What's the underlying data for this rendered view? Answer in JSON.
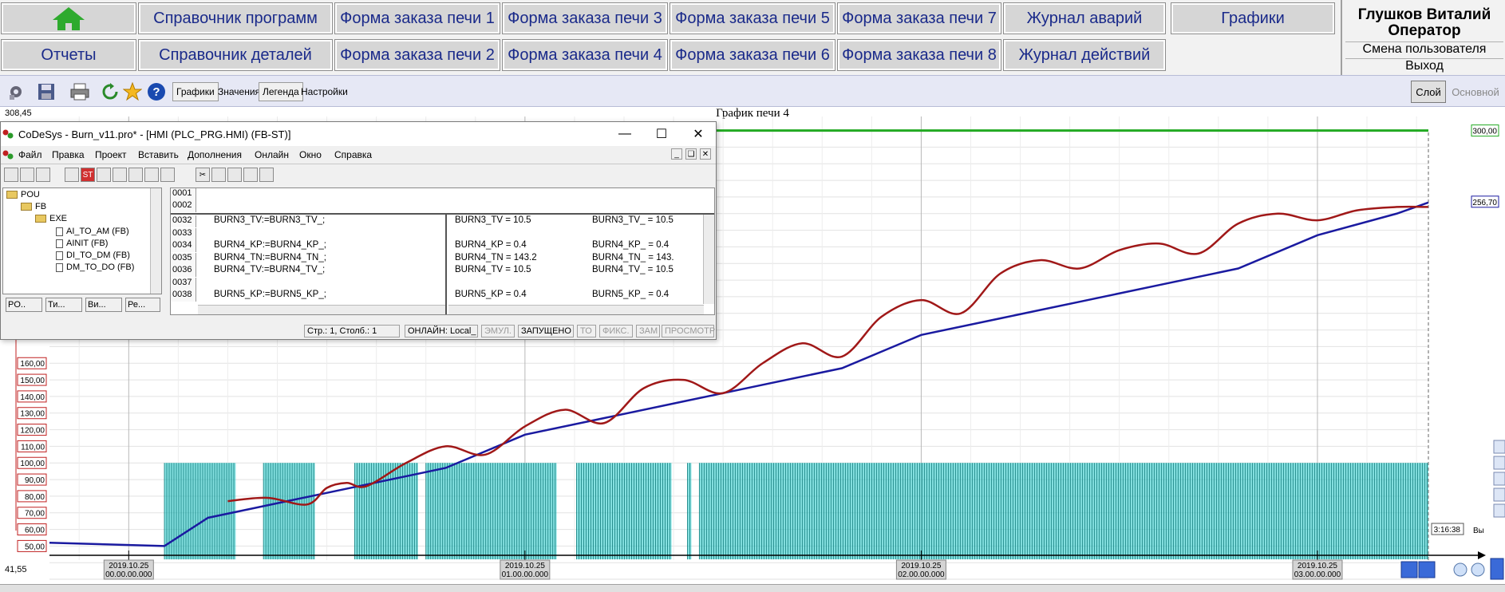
{
  "nav": {
    "row1": [
      "Справочник программ",
      "Форма заказа печи 1",
      "Форма заказа печи 3",
      "Форма заказа печи 5",
      "Форма заказа печи 7",
      "Журнал аварий",
      "Графики"
    ],
    "row2": [
      "Отчеты",
      "Справочник деталей",
      "Форма заказа печи 2",
      "Форма заказа печи 4",
      "Форма заказа печи 6",
      "Форма заказа печи 8",
      "Журнал действий"
    ],
    "home_icon": "home-icon"
  },
  "user": {
    "name": "Глушков Виталий",
    "role": "Оператор",
    "switch_label": "Смена пользователя",
    "exit_label": "Выход"
  },
  "toolbar": {
    "icons": [
      "settings-icon",
      "save-icon",
      "print-icon",
      "refresh-icon",
      "star-icon",
      "help-icon"
    ],
    "tabs": [
      "Графики",
      "Значения",
      "Легенда",
      "Настройки"
    ],
    "layer_label": "Слой",
    "main_label": "Основной"
  },
  "colors": {
    "nav_text": "#1a2a8a",
    "home_green": "#2eaa2e",
    "series_setpoint": "#1a1aa0",
    "series_actual": "#a01818",
    "series_limit": "#22aa22",
    "series_burner": "#20c8c8"
  },
  "chart": {
    "title": "График печи 4",
    "cursor_value": "308,45",
    "bottom_value": "41,55",
    "limit_label": "300,00",
    "current_label": "256,70",
    "time_label": "3:16:38",
    "cut_label": "Вы"
  },
  "chart_data": {
    "type": "line",
    "title": "График печи 4",
    "y_ticks": [
      "50,00",
      "60,00",
      "70,00",
      "80,00",
      "90,00",
      "100,00",
      "110,00",
      "120,00",
      "130,00",
      "140,00",
      "150,00",
      "160,00"
    ],
    "ylim": [
      41.55,
      308.45
    ],
    "x_ticks": [
      {
        "date": "2019.10.25",
        "time": "00.00.00.000"
      },
      {
        "date": "2019.10.25",
        "time": "01.00.00.000"
      },
      {
        "date": "2019.10.25",
        "time": "02.00.00.000"
      },
      {
        "date": "2019.10.25",
        "time": "03.00.00.000"
      }
    ],
    "grid": true,
    "series": [
      {
        "x": [
          -0.2,
          0.09,
          0.2,
          0.4,
          0.6,
          0.8,
          1.0,
          1.2,
          1.4,
          1.6,
          1.8,
          2.0,
          2.2,
          2.4,
          2.6,
          2.8,
          3.0,
          3.2,
          3.28
        ],
        "y": [
          52,
          50,
          67,
          77,
          87,
          97,
          117,
          127,
          137,
          147,
          157,
          177,
          187,
          197,
          207,
          217,
          237,
          250,
          256.7
        ]
      },
      {
        "x": [
          0.25,
          0.35,
          0.45,
          0.5,
          0.55,
          0.6,
          0.7,
          0.8,
          0.9,
          1.0,
          1.1,
          1.2,
          1.3,
          1.4,
          1.5,
          1.6,
          1.7,
          1.8,
          1.9,
          2.0,
          2.1,
          2.2,
          2.3,
          2.4,
          2.5,
          2.6,
          2.7,
          2.8,
          2.9,
          3.0,
          3.1,
          3.2,
          3.28
        ],
        "y": [
          77,
          79,
          75,
          85,
          88,
          86,
          100,
          110,
          105,
          122,
          132,
          124,
          145,
          150,
          142,
          160,
          172,
          164,
          188,
          198,
          190,
          214,
          222,
          217,
          228,
          232,
          226,
          244,
          250,
          246,
          252,
          254,
          254
        ]
      },
      {
        "x": [
          -0.2,
          3.28
        ],
        "y": [
          300,
          300
        ]
      }
    ],
    "burner_blocks": [
      [
        0.09,
        0.27
      ],
      [
        0.34,
        0.47
      ],
      [
        0.57,
        0.73
      ],
      [
        0.75,
        1.08
      ],
      [
        1.13,
        1.37
      ],
      [
        1.41,
        1.42
      ],
      [
        1.44,
        3.28
      ]
    ],
    "burner_level": 100
  },
  "codesys": {
    "title": "CoDeSys - Burn_v11.pro* - [HMI (PLC_PRG.HMI) (FB-ST)]",
    "menu": [
      "Файл",
      "Правка",
      "Проект",
      "Вставить",
      "Дополнения",
      "Онлайн",
      "Окно",
      "Справка"
    ],
    "tree": [
      {
        "label": "POU",
        "level": 0,
        "type": "folder"
      },
      {
        "label": "FB",
        "level": 1,
        "type": "folder"
      },
      {
        "label": "EXE",
        "level": 2,
        "type": "folder"
      },
      {
        "label": "AI_TO_AM (FB)",
        "level": 3,
        "type": "doc"
      },
      {
        "label": "AINIT (FB)",
        "level": 3,
        "type": "doc"
      },
      {
        "label": "DI_TO_DM (FB)",
        "level": 3,
        "type": "doc"
      },
      {
        "label": "DM_TO_DO (FB)",
        "level": 3,
        "type": "doc"
      }
    ],
    "tree_tabs": [
      "PO..",
      "Ти...",
      "Ви...",
      "Ре..."
    ],
    "header_lines": [
      "0001",
      "0002"
    ],
    "lines": [
      {
        "num": "0032",
        "code": "BURN3_TV:=BURN3_TV_;",
        "val1": "BURN3_TV = 10.5",
        "val2": "BURN3_TV_ = 10.5"
      },
      {
        "num": "0033",
        "code": "",
        "val1": "",
        "val2": ""
      },
      {
        "num": "0034",
        "code": "BURN4_KP:=BURN4_KP_;",
        "val1": "BURN4_KP = 0.4",
        "val2": "BURN4_KP_ = 0.4"
      },
      {
        "num": "0035",
        "code": "BURN4_TN:=BURN4_TN_;",
        "val1": "BURN4_TN = 143.2",
        "val2": "BURN4_TN_ = 143."
      },
      {
        "num": "0036",
        "code": "BURN4_TV:=BURN4_TV_;",
        "val1": "BURN4_TV = 10.5",
        "val2": "BURN4_TV_ = 10.5"
      },
      {
        "num": "0037",
        "code": "",
        "val1": "",
        "val2": ""
      },
      {
        "num": "0038",
        "code": "BURN5_KP:=BURN5_KP_;",
        "val1": "BURN5_KP = 0.4",
        "val2": "BURN5_KP_ = 0.4"
      }
    ],
    "status": {
      "position": "Стр.: 1, Столб.: 1",
      "online": "ОНЛАЙН: Local_",
      "emul": "ЭМУЛ.",
      "running": "ЗАПУЩЕНО",
      "to": "ТО",
      "fix": "ФИКС.",
      "zam": "ЗАМ",
      "view": "ПРОСМОТР"
    }
  }
}
